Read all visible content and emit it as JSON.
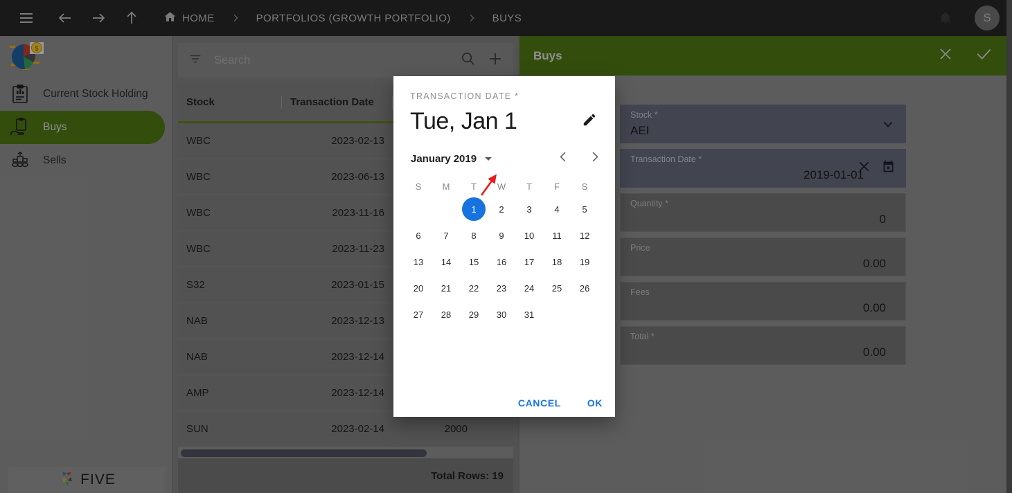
{
  "topbar": {
    "menu_icon": "hamburger-icon",
    "back_icon": "arrow-left-icon",
    "forward_icon": "arrow-right-icon",
    "up_icon": "arrow-up-icon",
    "breadcrumbs": [
      {
        "label": "HOME",
        "icon": "home-icon"
      },
      {
        "label": "PORTFOLIOS (GROWTH PORTFOLIO)",
        "icon": ""
      },
      {
        "label": "BUYS",
        "icon": ""
      }
    ],
    "separator": "›",
    "notification_icon": "bell-icon",
    "avatar_initial": "S"
  },
  "sidebar": {
    "logo": "portfolio-pie-chart-logo",
    "items": [
      {
        "label": "Current Stock Holding",
        "icon": "clipboard-chart-icon",
        "active": false
      },
      {
        "label": "Buys",
        "icon": "hand-clipboard-icon",
        "active": true
      },
      {
        "label": "Sells",
        "icon": "coins-podium-icon",
        "active": false
      }
    ],
    "footer_logo_text": "FIVE"
  },
  "list_panel": {
    "search": {
      "placeholder": "Search",
      "filter_icon": "filter-icon",
      "search_icon": "search-icon",
      "add_icon": "plus-icon"
    },
    "columns": [
      "Stock",
      "Transaction Date",
      ""
    ],
    "rows": [
      {
        "stock": "WBC",
        "date": "2023-02-13",
        "qty": ""
      },
      {
        "stock": "WBC",
        "date": "2023-06-13",
        "qty": ""
      },
      {
        "stock": "WBC",
        "date": "2023-11-16",
        "qty": ""
      },
      {
        "stock": "WBC",
        "date": "2023-11-23",
        "qty": ""
      },
      {
        "stock": "S32",
        "date": "2023-01-15",
        "qty": ""
      },
      {
        "stock": "NAB",
        "date": "2023-12-13",
        "qty": ""
      },
      {
        "stock": "NAB",
        "date": "2023-12-14",
        "qty": ""
      },
      {
        "stock": "AMP",
        "date": "2023-12-14",
        "qty": ""
      },
      {
        "stock": "SUN",
        "date": "2023-02-14",
        "qty": "2000"
      }
    ],
    "total_rows": "Total Rows: 19"
  },
  "form": {
    "title": "Buys",
    "close_icon": "close-icon",
    "confirm_icon": "check-icon",
    "fields": [
      {
        "label": "Stock *",
        "value": "AEI",
        "icon": "chevron-down-icon",
        "align": "left",
        "highlight": true
      },
      {
        "label": "Transaction Date *",
        "value": "2019-01-01",
        "icon": "clear-and-calendar-icon",
        "align": "right",
        "highlight": true
      },
      {
        "label": "Quantity *",
        "value": "0",
        "icon": "",
        "align": "right",
        "highlight": false
      },
      {
        "label": "Price",
        "value": "0.00",
        "icon": "",
        "align": "right",
        "highlight": false
      },
      {
        "label": "Fees",
        "value": "0.00",
        "icon": "",
        "align": "right",
        "highlight": false
      },
      {
        "label": "Total *",
        "value": "0.00",
        "icon": "",
        "align": "right",
        "highlight": false
      }
    ]
  },
  "dialog": {
    "header_label": "TRANSACTION DATE *",
    "selected_date_text": "Tue, Jan 1",
    "edit_icon": "pencil-icon",
    "month_label": "January 2019",
    "caret_icon": "triangle-down-icon",
    "prev_icon": "chevron-left-icon",
    "next_icon": "chevron-right-icon",
    "dow": [
      "S",
      "M",
      "T",
      "W",
      "T",
      "F",
      "S"
    ],
    "weeks": [
      [
        "",
        "",
        "1",
        "2",
        "3",
        "4",
        "5"
      ],
      [
        "6",
        "7",
        "8",
        "9",
        "10",
        "11",
        "12"
      ],
      [
        "13",
        "14",
        "15",
        "16",
        "17",
        "18",
        "19"
      ],
      [
        "20",
        "21",
        "22",
        "23",
        "24",
        "25",
        "26"
      ],
      [
        "27",
        "28",
        "29",
        "30",
        "31",
        "",
        ""
      ]
    ],
    "selected_day": "1",
    "cancel_label": "CANCEL",
    "ok_label": "OK"
  },
  "colors": {
    "accent_green": "#4d7314",
    "selection_blue": "#1673df",
    "link_blue": "#1a73e8",
    "topbar_bg": "#262626",
    "annotation_red": "#e81c1c"
  }
}
